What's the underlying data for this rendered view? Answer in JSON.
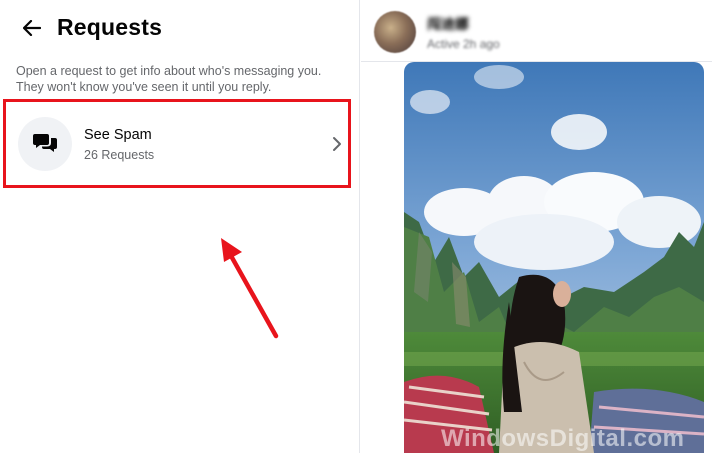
{
  "header": {
    "title": "Requests"
  },
  "description": "Open a request to get info about who's messaging you. They won't know you've seen it until you reply.",
  "request_item": {
    "title": "See Spam",
    "count": "26 Requests"
  },
  "chat": {
    "name": "闯迪娜",
    "status": "Active 2h ago"
  },
  "watermark": "WindowsDigital.com",
  "colors": {
    "highlight": "#e8141c",
    "secondary_text": "#65676b",
    "icon_bg": "#f0f2f5"
  },
  "icons": {
    "back": "arrow-left-icon",
    "request": "chat-bubbles-icon",
    "chevron": "chevron-right-icon"
  }
}
